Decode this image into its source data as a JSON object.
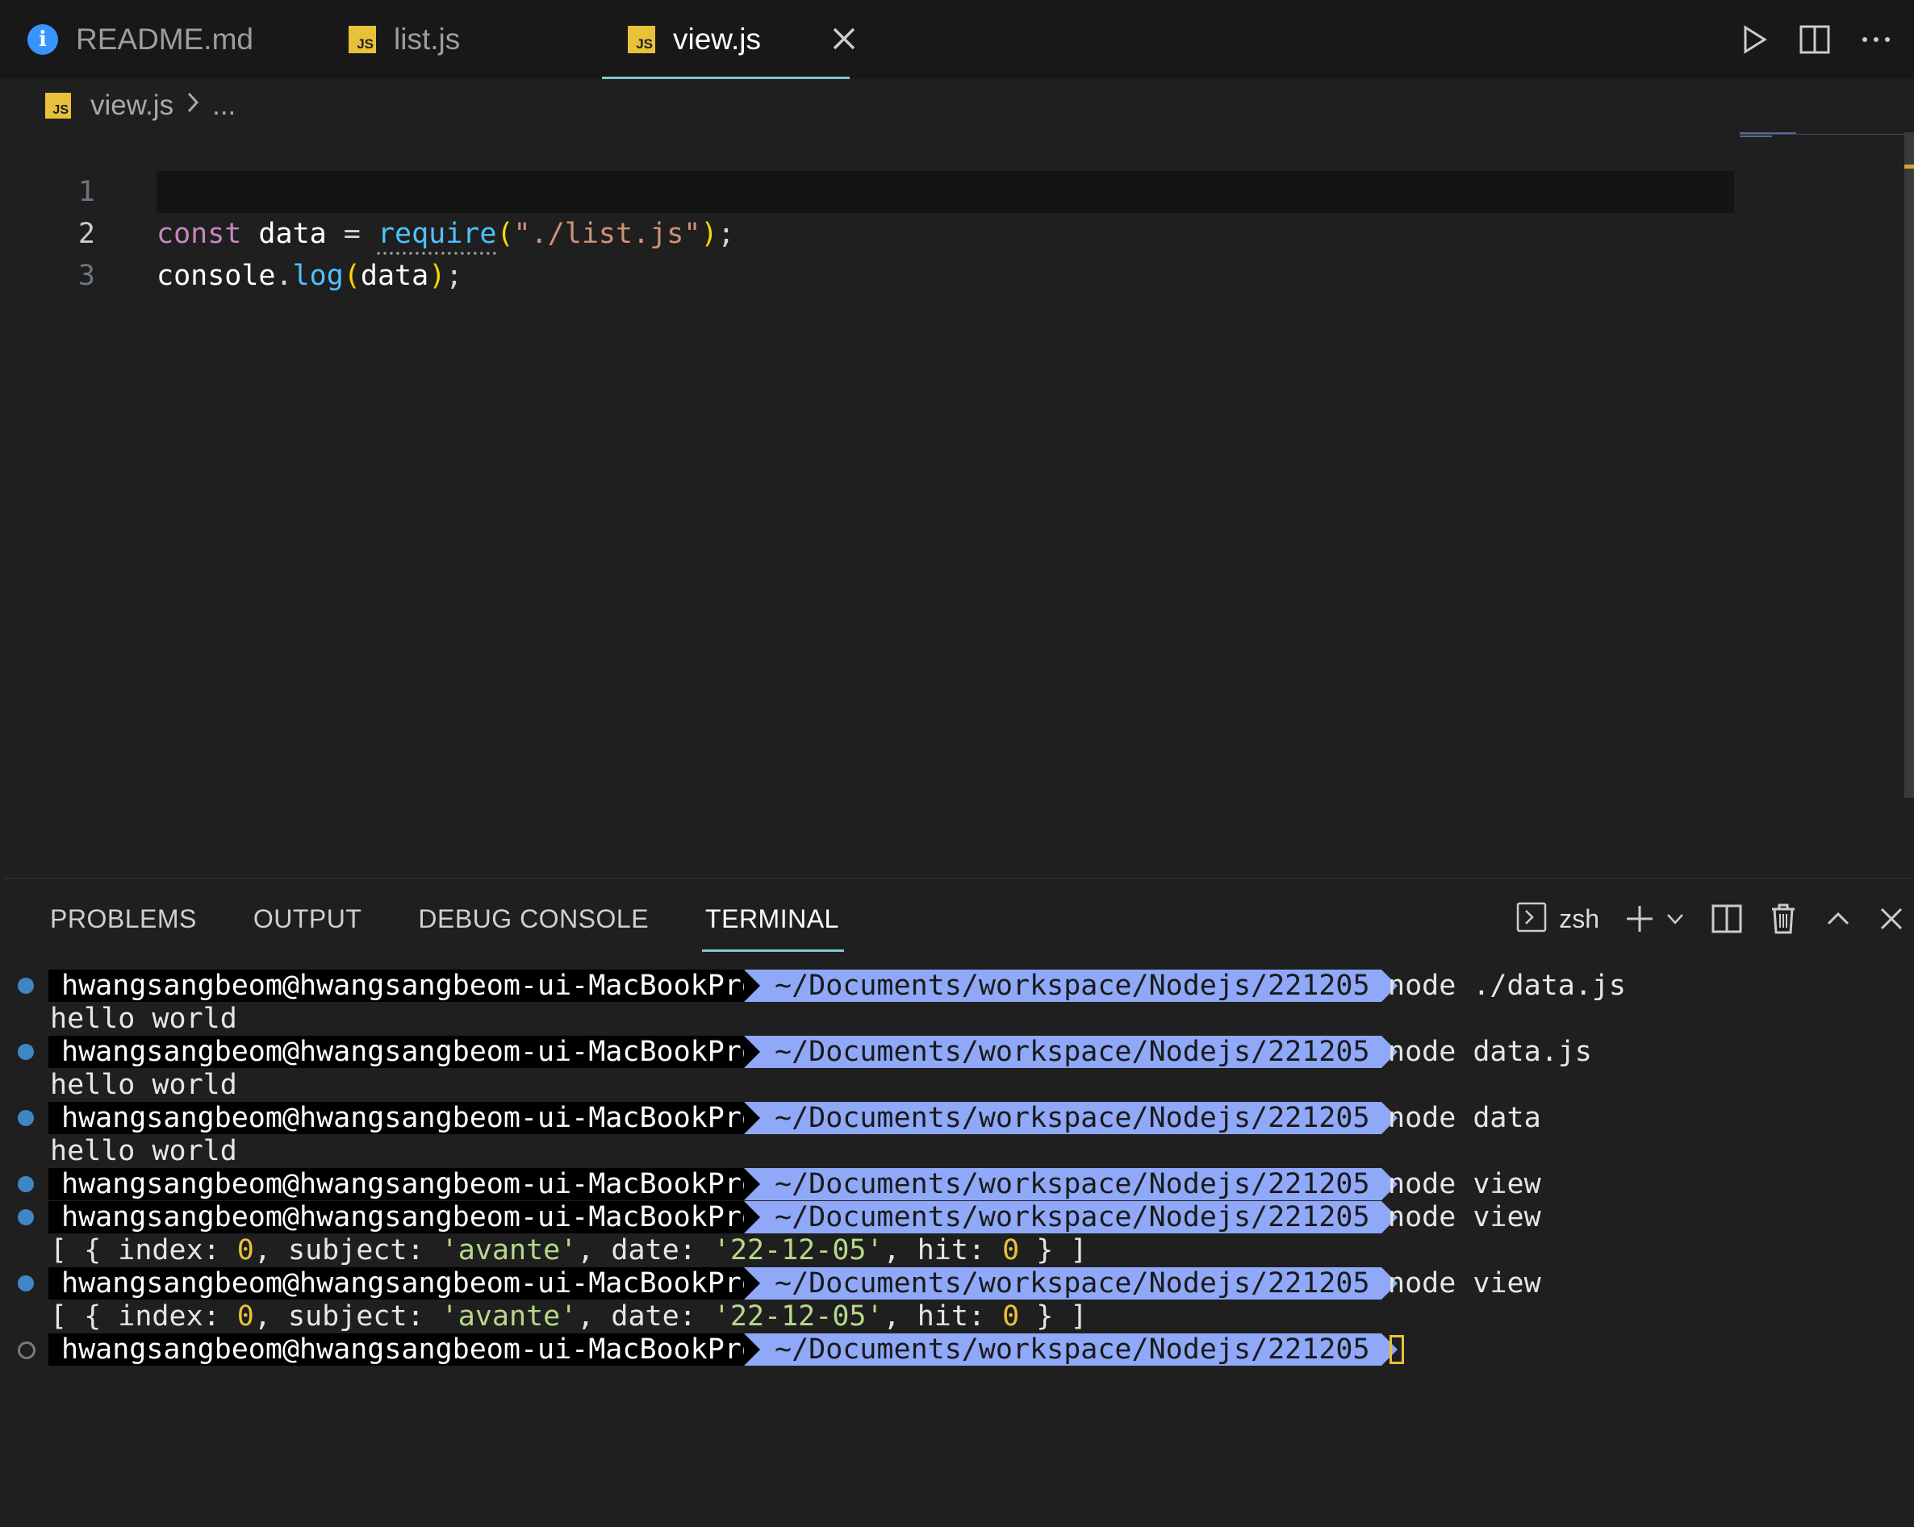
{
  "tabs": [
    {
      "label": "README.md",
      "icon": "info-icon",
      "active": false
    },
    {
      "label": "list.js",
      "icon": "js-icon",
      "active": false
    },
    {
      "label": "view.js",
      "icon": "js-icon",
      "active": true
    }
  ],
  "js_icon_text": "JS",
  "info_icon_text": "i",
  "breadcrumb": {
    "file": "view.js",
    "rest": "..."
  },
  "editor": {
    "line_numbers": [
      "1",
      "2",
      "3"
    ],
    "line1": {
      "const": "const",
      "name": " data ",
      "eq": "=",
      "space": " ",
      "require": "require",
      "open": "(",
      "str": "\"./list.js\"",
      "close": ")",
      "semi": ";"
    },
    "line2": {
      "obj": "console",
      "dot": ".",
      "method": "log",
      "open": "(",
      "arg": "data",
      "close": ")",
      "semi": ";"
    }
  },
  "panel": {
    "tabs": [
      "PROBLEMS",
      "OUTPUT",
      "DEBUG CONSOLE",
      "TERMINAL"
    ],
    "active_tab": "TERMINAL",
    "shell": "zsh"
  },
  "terminal": {
    "user": "hwangsangbeom@hwangsangbeom-ui-MacBookPro",
    "path": "~/Documents/workspace/Nodejs/221205",
    "commands": [
      "node ./data.js",
      "node data.js",
      "node data",
      "node view",
      "node view",
      "node view"
    ],
    "hello": "hello world",
    "result": {
      "open": "[ { index: ",
      "index": "0",
      "subj_key": ", subject: ",
      "subject": "'avante'",
      "date_key": ", date: ",
      "date": "'22-12-05'",
      "hit_key": ", hit: ",
      "hit": "0",
      "close": " } ]"
    }
  },
  "colors": {
    "accent": "#7ecad3",
    "path_bg": "#8fa8f8",
    "js_yellow": "#e8c13a",
    "dot_blue": "#3f87c4"
  }
}
